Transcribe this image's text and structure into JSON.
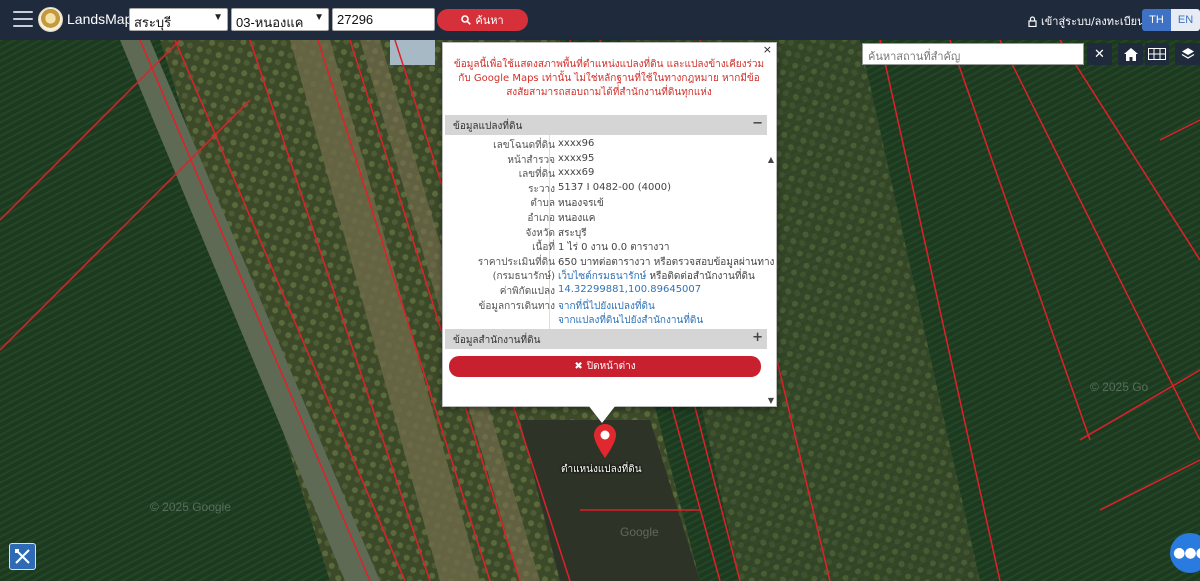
{
  "app": {
    "brand": "LandsMaps"
  },
  "search": {
    "province": "สระบุรี",
    "district": "03-หนองแค",
    "parcel_no": "27296",
    "button_label": "ค้นหา"
  },
  "auth": {
    "login_label": "เข้าสู่ระบบ/ลงทะเบียน"
  },
  "lang": {
    "th": "TH",
    "en": "EN"
  },
  "place_search": {
    "placeholder": "ค้นหาสถานที่สำคัญ",
    "clear": "✕"
  },
  "popup": {
    "close_x": "×",
    "disclaimer": "ข้อมูลนี้เพื่อใช้แสดงสภาพพื้นที่ตำแหน่งแปลงที่ดิน และแปลงข้างเคียงร่วมกับ Google Maps เท่านั้น ไม่ใช่หลักฐานที่ใช้ในทางกฎหมาย หากมีข้อสงสัยสามารถสอบถามได้ที่สำนักงานที่ดินทุกแห่ง",
    "section_parcel": "ข้อมูลแปลงที่ดิน",
    "section_parcel_sign": "−",
    "section_office": "ข้อมูลสำนักงานที่ดิน",
    "section_office_sign": "+",
    "rows": [
      {
        "k": "เลขโฉนดที่ดิน",
        "v": "xxxx96"
      },
      {
        "k": "หน้าสำรวจ",
        "v": "xxxx95"
      },
      {
        "k": "เลขที่ดิน",
        "v": "xxxx69"
      },
      {
        "k": "ระวาง",
        "v": "5137 I 0482-00 (4000)"
      },
      {
        "k": "ตำบล",
        "v": "หนองจรเข้"
      },
      {
        "k": "อำเภอ",
        "v": "หนองแค"
      },
      {
        "k": "จังหวัด",
        "v": "สระบุรี"
      },
      {
        "k": "เนื้อที่",
        "v": "1 ไร่ 0 งาน 0.0 ตารางวา"
      },
      {
        "k": "ราคาประเมินที่ดิน",
        "v": "650 บาทต่อตารางวา หรือตรวจสอบข้อมูลผ่านทาง"
      },
      {
        "k": "(กรมธนารักษ์)",
        "v_link": "เว็บไซต์กรมธนารักษ์",
        "v": " หรือติดต่อสำนักงานที่ดิน"
      },
      {
        "k": "ค่าพิกัดแปลง",
        "v_link": "14.32299881,100.89645007"
      },
      {
        "k": "ข้อมูลการเดินทาง",
        "v_link": "จากที่นี่ไปยังแปลงที่ดิน"
      },
      {
        "k": "",
        "v_link": "จากแปลงที่ดินไปยังสำนักงานที่ดิน"
      }
    ],
    "close_window_label": "ปิดหน้าต่าง"
  },
  "marker": {
    "label": "ตำแหน่งแปลงที่ดิน"
  },
  "watermarks": [
    "© 2025 Google",
    "© 2025 Google",
    "Google",
    "© 2025 Go"
  ],
  "colors": {
    "topbar": "#1f2a3c",
    "accent_red": "#d6303b",
    "accent_blue": "#3f72c4",
    "parcel_lines": "#e0202a"
  }
}
